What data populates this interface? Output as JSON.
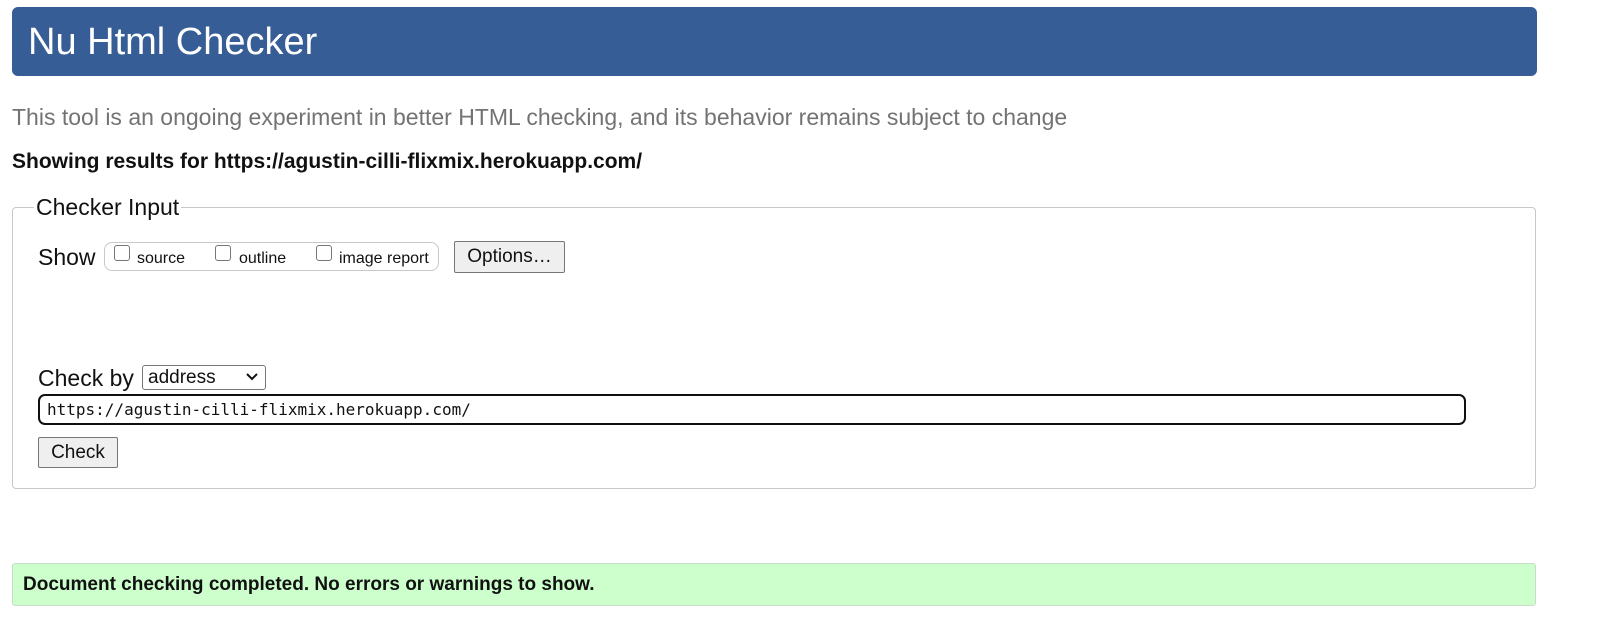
{
  "header": {
    "title": "Nu Html Checker",
    "background_color": "#365d95"
  },
  "intro_text": "This tool is an ongoing experiment in better HTML checking, and its behavior remains subject to change",
  "results_heading": "Showing results for https://agustin-cilli-flixmix.herokuapp.com/",
  "checker_input": {
    "legend": "Checker Input",
    "show_label": "Show",
    "show_options": [
      {
        "label": "source",
        "checked": false
      },
      {
        "label": "outline",
        "checked": false
      },
      {
        "label": "image report",
        "checked": false
      }
    ],
    "options_button": "Options…",
    "check_by_label": "Check by",
    "check_by_selected": "address",
    "check_by_icon": "chevron-down-icon",
    "url_value": "https://agustin-cilli-flixmix.herokuapp.com/",
    "check_button": "Check"
  },
  "result_message": {
    "text": "Document checking completed. No errors or warnings to show.",
    "background_color": "#ccffcc"
  }
}
